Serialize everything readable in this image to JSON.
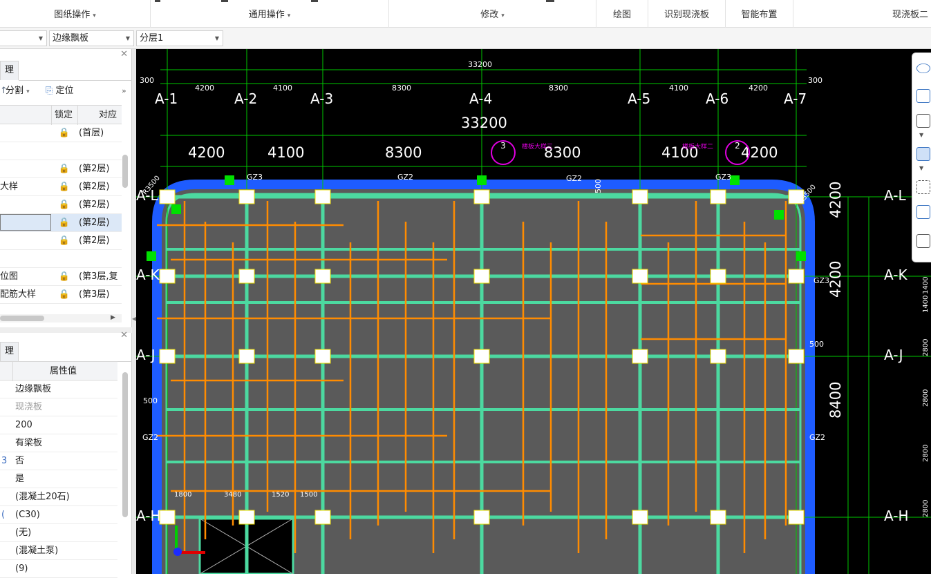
{
  "ribbon": {
    "groups": [
      {
        "label": "图纸操作",
        "caret": "▾"
      },
      {
        "label": "通用操作",
        "caret": "▾"
      },
      {
        "label": "修改",
        "caret": "▾"
      },
      {
        "label": "绘图"
      },
      {
        "label": "识别现浇板"
      },
      {
        "label": "智能布置"
      },
      {
        "label": "现浇板二"
      }
    ]
  },
  "selectors": {
    "first": "",
    "component": "边缘飘板",
    "layer": "分层1"
  },
  "drawing_panel": {
    "tab_label": "理",
    "tools": [
      "分割",
      "定位"
    ],
    "tool_caret": "▾",
    "more": "»",
    "columns": {
      "lock": "锁定",
      "match": "对应"
    },
    "rows": [
      {
        "name": "",
        "lock": "🔒",
        "match": "(首层)"
      },
      {
        "name": "",
        "lock": "",
        "match": ""
      },
      {
        "name": "",
        "lock": "🔒",
        "match": "(第2层)"
      },
      {
        "name": "大样",
        "lock": "🔒",
        "match": "(第2层)"
      },
      {
        "name": "",
        "lock": "🔒",
        "match": "(第2层)"
      },
      {
        "name": "",
        "lock": "🔒",
        "match": "(第2层)",
        "selected": true
      },
      {
        "name": "",
        "lock": "🔒",
        "match": "(第2层)"
      },
      {
        "name": "",
        "lock": "",
        "match": ""
      },
      {
        "name": "位图",
        "lock": "🔒",
        "match": "(第3层,复"
      },
      {
        "name": "配筋大样",
        "lock": "🔒",
        "match": "(第3层)"
      }
    ]
  },
  "property_panel": {
    "tab_label": "理",
    "header": "属性值",
    "rows": [
      {
        "key": "",
        "value": "边缘飘板"
      },
      {
        "key": "",
        "value": "现浇板",
        "muted": true
      },
      {
        "key": "",
        "value": "200"
      },
      {
        "key": "",
        "value": "有梁板"
      },
      {
        "key": "3",
        "value": "否"
      },
      {
        "key": "",
        "value": "是"
      },
      {
        "key": "",
        "value": "(混凝土20石)"
      },
      {
        "key": "(",
        "value": "(C30)"
      },
      {
        "key": "",
        "value": "(无)"
      },
      {
        "key": "",
        "value": "(混凝土泵)"
      },
      {
        "key": "",
        "value": "(9)"
      }
    ]
  },
  "cad": {
    "total_dim_small": "33200",
    "total_dim": "33200",
    "edge_dim": "300",
    "grid_x": [
      "A-1",
      "A-2",
      "A-3",
      "A-4",
      "A-5",
      "A-6",
      "A-7"
    ],
    "spans_small": [
      "4200",
      "4100",
      "8300",
      "8300",
      "4100",
      "4200"
    ],
    "spans": [
      "4200",
      "4100",
      "8300",
      "8300",
      "4100",
      "4200"
    ],
    "grid_y": [
      "A-L",
      "A-K",
      "A-J",
      "A-H"
    ],
    "spans_y": [
      "4200",
      "4200",
      "8400"
    ],
    "right_dims_small": [
      "1400",
      "1400",
      "2800",
      "2800",
      "2800",
      "2800"
    ],
    "labels": {
      "gz3": "GZ3",
      "gz2": "GZ2",
      "r": "R3500",
      "d500": "500",
      "d1800": "1800",
      "d3480": "3480",
      "d1520": "1520",
      "d1500": "1500",
      "callout3": "3",
      "callout2": "2",
      "callout3_text": "楼板大样三",
      "callout2_text": "楼板大样二"
    },
    "colors": {
      "background": "#000000",
      "slab": "#5a5a5a",
      "grid": "#00c800",
      "beam": "#4cd9a0",
      "rebar": "#ff8c00",
      "edge": "#1e5cff",
      "column": "#ffffff"
    }
  }
}
